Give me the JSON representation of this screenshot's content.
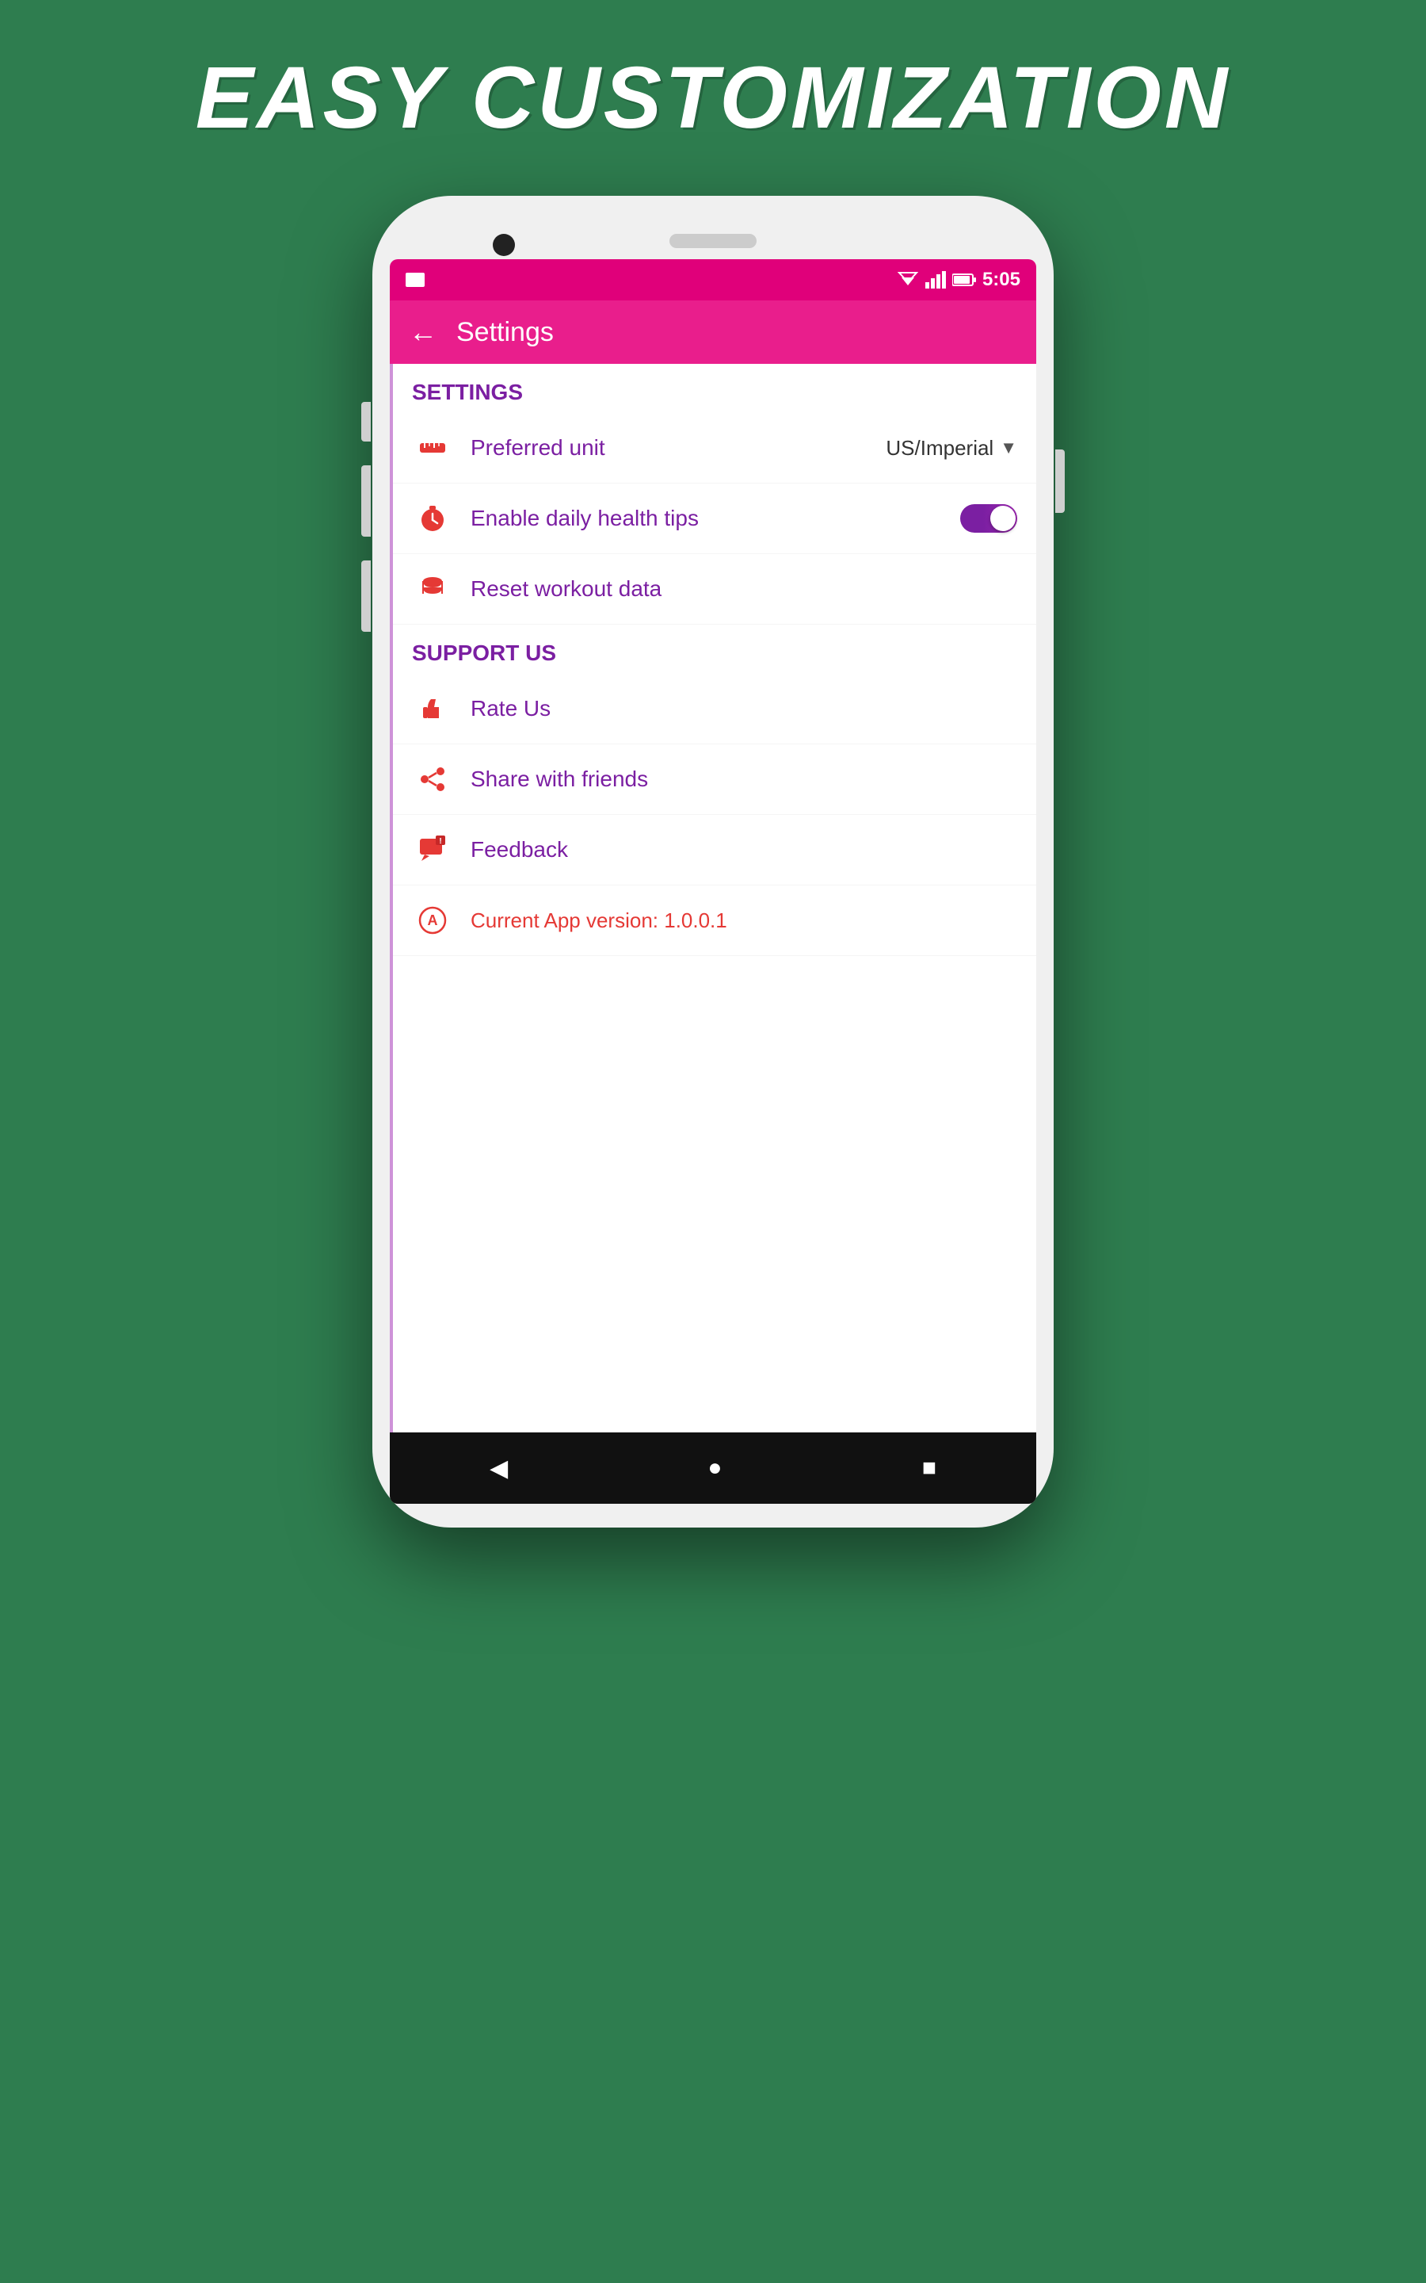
{
  "header": {
    "title": "EASY CUSTOMIZATION"
  },
  "statusBar": {
    "time": "5:05"
  },
  "appBar": {
    "title": "Settings",
    "backLabel": "←"
  },
  "settings": {
    "sectionLabel": "SETTINGS",
    "items": [
      {
        "id": "preferred-unit",
        "label": "Preferred unit",
        "value": "US/Imperial",
        "type": "dropdown",
        "icon": "ruler"
      },
      {
        "id": "health-tips",
        "label": "Enable daily health tips",
        "type": "toggle",
        "enabled": true,
        "icon": "timer"
      },
      {
        "id": "reset-workout",
        "label": "Reset workout data",
        "type": "action",
        "icon": "database"
      }
    ]
  },
  "supportUs": {
    "sectionLabel": "SUPPORT US",
    "items": [
      {
        "id": "rate-us",
        "label": "Rate Us",
        "icon": "thumb"
      },
      {
        "id": "share-friends",
        "label": "Share with friends",
        "icon": "share"
      },
      {
        "id": "feedback",
        "label": "Feedback",
        "icon": "feedback"
      },
      {
        "id": "app-version",
        "label": "Current App version: 1.0.0.1",
        "icon": "appstore"
      }
    ]
  },
  "navBar": {
    "back": "◀",
    "home": "●",
    "recent": "■"
  }
}
